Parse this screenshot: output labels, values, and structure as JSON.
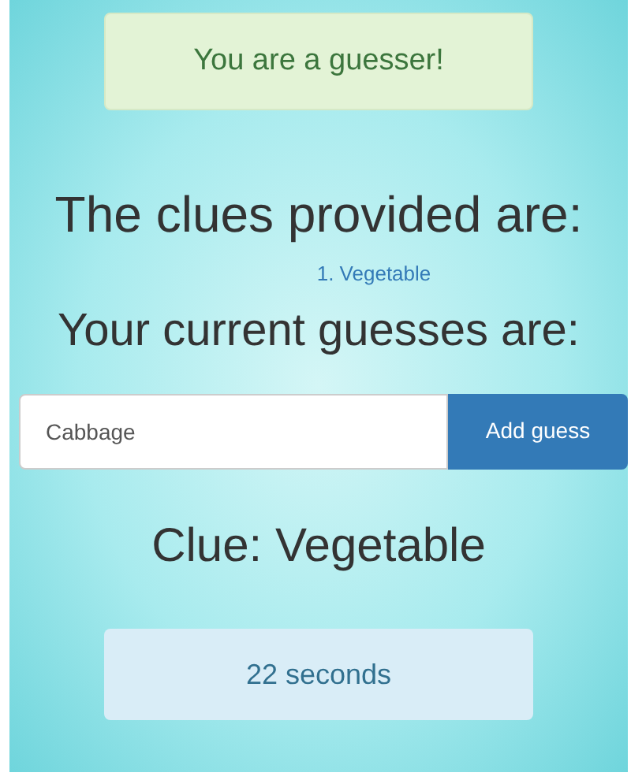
{
  "role_alert": "You are a guesser!",
  "clues_heading": "The clues provided are:",
  "clues": [
    "1. Vegetable"
  ],
  "guesses_heading": "Your current guesses are:",
  "guess_input": {
    "value": "Cabbage"
  },
  "add_button": "Add guess",
  "current_clue": "Clue: Vegetable",
  "timer": "22 seconds"
}
